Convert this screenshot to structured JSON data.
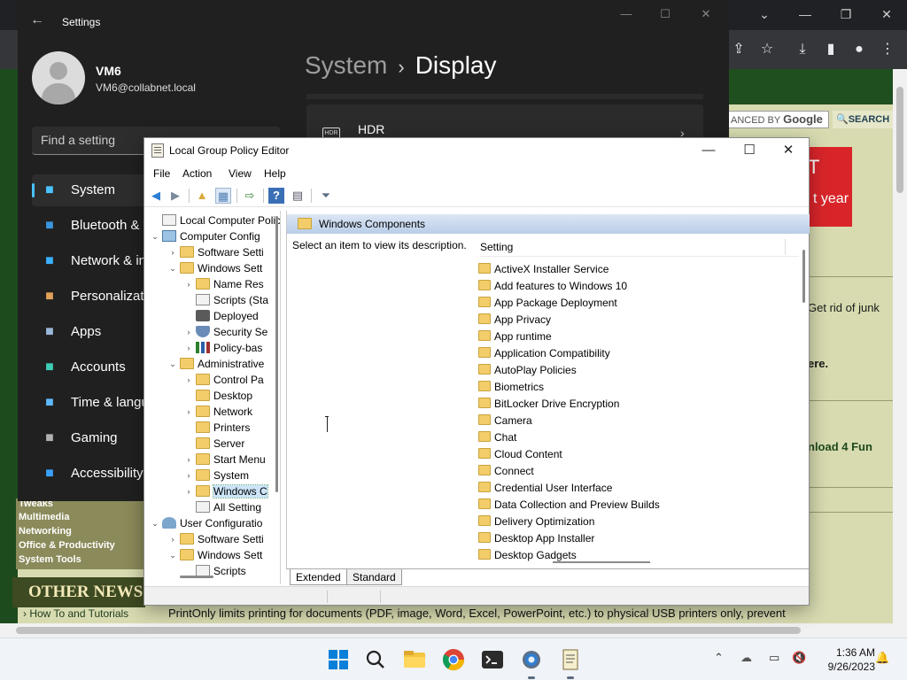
{
  "browser": {
    "google_text": "ANCED BY",
    "google_brand": "Google",
    "search_btn": "SEARCH",
    "ad_line1": "T",
    "ad_line2": "t year",
    "web_text1": "Get rid of junk",
    "web_text2": "ere.",
    "web_text3": "nload 4 Fun",
    "categories": [
      "Tweaks",
      "Multimedia",
      "Networking",
      "Office & Productivity",
      "System Tools"
    ],
    "other_news": "OTHER NEWS",
    "howto": "How To and Tutorials",
    "printonly": "PrintOnly limits printing for documents (PDF, image, Word, Excel, PowerPoint, etc.) to physical USB printers only, prevent"
  },
  "settings": {
    "title": "Settings",
    "user_name": "VM6",
    "user_email": "VM6@collabnet.local",
    "search_placeholder": "Find a setting",
    "nav": [
      {
        "label": "System",
        "icon": "monitor-icon",
        "color": "#4cc2ff"
      },
      {
        "label": "Bluetooth & d",
        "icon": "bluetooth-icon",
        "color": "#3a96dd"
      },
      {
        "label": "Network & in",
        "icon": "wifi-icon",
        "color": "#3ab0ff"
      },
      {
        "label": "Personalizati",
        "icon": "brush-icon",
        "color": "#e2a058"
      },
      {
        "label": "Apps",
        "icon": "apps-icon",
        "color": "#9ab8d8"
      },
      {
        "label": "Accounts",
        "icon": "person-icon",
        "color": "#3ccfb5"
      },
      {
        "label": "Time & langu",
        "icon": "globe-clock-icon",
        "color": "#5fb8ff"
      },
      {
        "label": "Gaming",
        "icon": "gamepad-icon",
        "color": "#b0b0b0"
      },
      {
        "label": "Accessibility",
        "icon": "accessibility-icon",
        "color": "#3aa0ff"
      }
    ],
    "breadcrumb_parent": "System",
    "breadcrumb_sep": "›",
    "breadcrumb_current": "Display",
    "hdr_label": "HDR",
    "hdr_icon_text": "HDR"
  },
  "gpe": {
    "title": "Local Group Policy Editor",
    "menu": [
      "File",
      "Action",
      "View",
      "Help"
    ],
    "tree": [
      {
        "label": "Local Computer Polic",
        "icon": "doc",
        "level": 0,
        "exp": ""
      },
      {
        "label": "Computer Config",
        "icon": "computer",
        "level": 0,
        "exp": "⌄"
      },
      {
        "label": "Software Setti",
        "icon": "folder",
        "level": 1,
        "exp": "›"
      },
      {
        "label": "Windows Sett",
        "icon": "folder",
        "level": 1,
        "exp": "⌄"
      },
      {
        "label": "Name Res",
        "icon": "folder",
        "level": 2,
        "exp": "›"
      },
      {
        "label": "Scripts (Sta",
        "icon": "doc",
        "level": 2,
        "exp": ""
      },
      {
        "label": "Deployed",
        "icon": "printer",
        "level": 2,
        "exp": ""
      },
      {
        "label": "Security Se",
        "icon": "shield",
        "level": 2,
        "exp": "›"
      },
      {
        "label": "Policy-bas",
        "icon": "chart",
        "level": 2,
        "exp": "›"
      },
      {
        "label": "Administrative",
        "icon": "folder",
        "level": 1,
        "exp": "⌄"
      },
      {
        "label": "Control Pa",
        "icon": "folder",
        "level": 2,
        "exp": "›"
      },
      {
        "label": "Desktop",
        "icon": "folder",
        "level": 2,
        "exp": ""
      },
      {
        "label": "Network",
        "icon": "folder",
        "level": 2,
        "exp": "›"
      },
      {
        "label": "Printers",
        "icon": "folder",
        "level": 2,
        "exp": ""
      },
      {
        "label": "Server",
        "icon": "folder",
        "level": 2,
        "exp": ""
      },
      {
        "label": "Start Menu",
        "icon": "folder",
        "level": 2,
        "exp": "›"
      },
      {
        "label": "System",
        "icon": "folder",
        "level": 2,
        "exp": "›"
      },
      {
        "label": "Windows C",
        "icon": "folder",
        "level": 2,
        "exp": "›",
        "selected": true
      },
      {
        "label": "All Setting",
        "icon": "doc",
        "level": 2,
        "exp": ""
      },
      {
        "label": "User Configuratio",
        "icon": "user",
        "level": 0,
        "exp": "⌄"
      },
      {
        "label": "Software Setti",
        "icon": "folder",
        "level": 1,
        "exp": "›"
      },
      {
        "label": "Windows Sett",
        "icon": "folder",
        "level": 1,
        "exp": "⌄"
      },
      {
        "label": "Scripts",
        "icon": "doc",
        "level": 2,
        "exp": ""
      }
    ],
    "header": "Windows Components",
    "description": "Select an item to view its description.",
    "column": "Setting",
    "items": [
      "ActiveX Installer Service",
      "Add features to Windows 10",
      "App Package Deployment",
      "App Privacy",
      "App runtime",
      "Application Compatibility",
      "AutoPlay Policies",
      "Biometrics",
      "BitLocker Drive Encryption",
      "Camera",
      "Chat",
      "Cloud Content",
      "Connect",
      "Credential User Interface",
      "Data Collection and Preview Builds",
      "Delivery Optimization",
      "Desktop App Installer",
      "Desktop Gadgets"
    ],
    "tabs": [
      "Extended",
      "Standard"
    ]
  },
  "taskbar": {
    "time": "1:36 AM",
    "date": "9/26/2023"
  }
}
